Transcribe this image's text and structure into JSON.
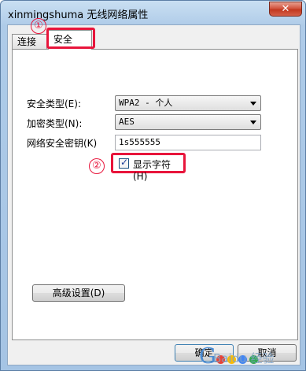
{
  "window": {
    "title": "xinmingshuma 无线网络属性",
    "close_glyph": "✕"
  },
  "tabs": [
    {
      "label": "连接"
    },
    {
      "label": "安全"
    }
  ],
  "form": {
    "security_type_label": "安全类型(E):",
    "security_type_value": "WPA2 - 个人",
    "encryption_type_label": "加密类型(N):",
    "encryption_type_value": "AES",
    "network_key_label": "网络安全密钥(K)",
    "network_key_value": "1s555555",
    "show_characters_label": "显示字符(H)",
    "show_characters_checked": true
  },
  "buttons": {
    "advanced": "高级设置(D)",
    "ok": "确定",
    "cancel": "取消"
  },
  "annotations": {
    "step1": "①",
    "step2": "②",
    "color": "#e8153b"
  },
  "watermark": {
    "glyph": "G",
    "text": "Baidu 经验"
  }
}
